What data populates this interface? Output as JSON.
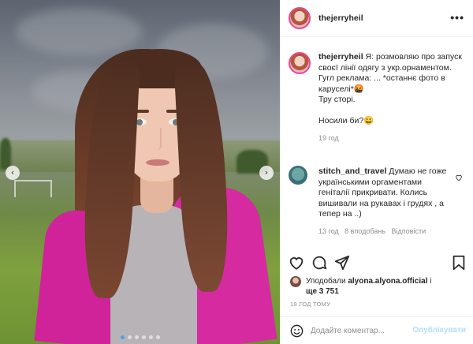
{
  "post": {
    "username": "thejerryheil",
    "caption": {
      "username": "thejerryheil",
      "lines": [
        "Я: розмовляю про запуск своєї лінії одягу з укр.орнаментом.",
        "Гугл реклама: ... *останнє фото в каруселі*🤬",
        "Тру сторі.",
        "Носили би?😀"
      ],
      "time": "19 год"
    },
    "comments": [
      {
        "username": "stitch_and_travel",
        "text": "Думаю не гоже українськими оргаментами геніталії прикривати. Колись вишивали на рукавах і грудях , а тепер на ..)",
        "time": "13 год",
        "likes": "8 вподобань",
        "reply": "Відповісти"
      }
    ],
    "liked_by": {
      "prefix": "Уподобали",
      "user": "alyona.alyona.official",
      "and": "і",
      "others": "ще 3 751"
    },
    "timestamp": "19 ГОД ТОМУ",
    "add_comment_placeholder": "Додайте коментар...",
    "publish_label": "Опублікувати",
    "more_label": "•••",
    "carousel": {
      "count": 6,
      "active_index": 0
    }
  },
  "icons": {
    "heart": "heart-icon",
    "comment": "comment-icon",
    "share": "share-icon",
    "save": "bookmark-icon",
    "emoji": "emoji-icon",
    "prev": "chevron-left-icon",
    "next": "chevron-right-icon"
  },
  "colors": {
    "accent_link": "#b2dffc",
    "text": "#262626",
    "muted": "#8e8e8e",
    "jacket_pink": "#d0239a"
  }
}
